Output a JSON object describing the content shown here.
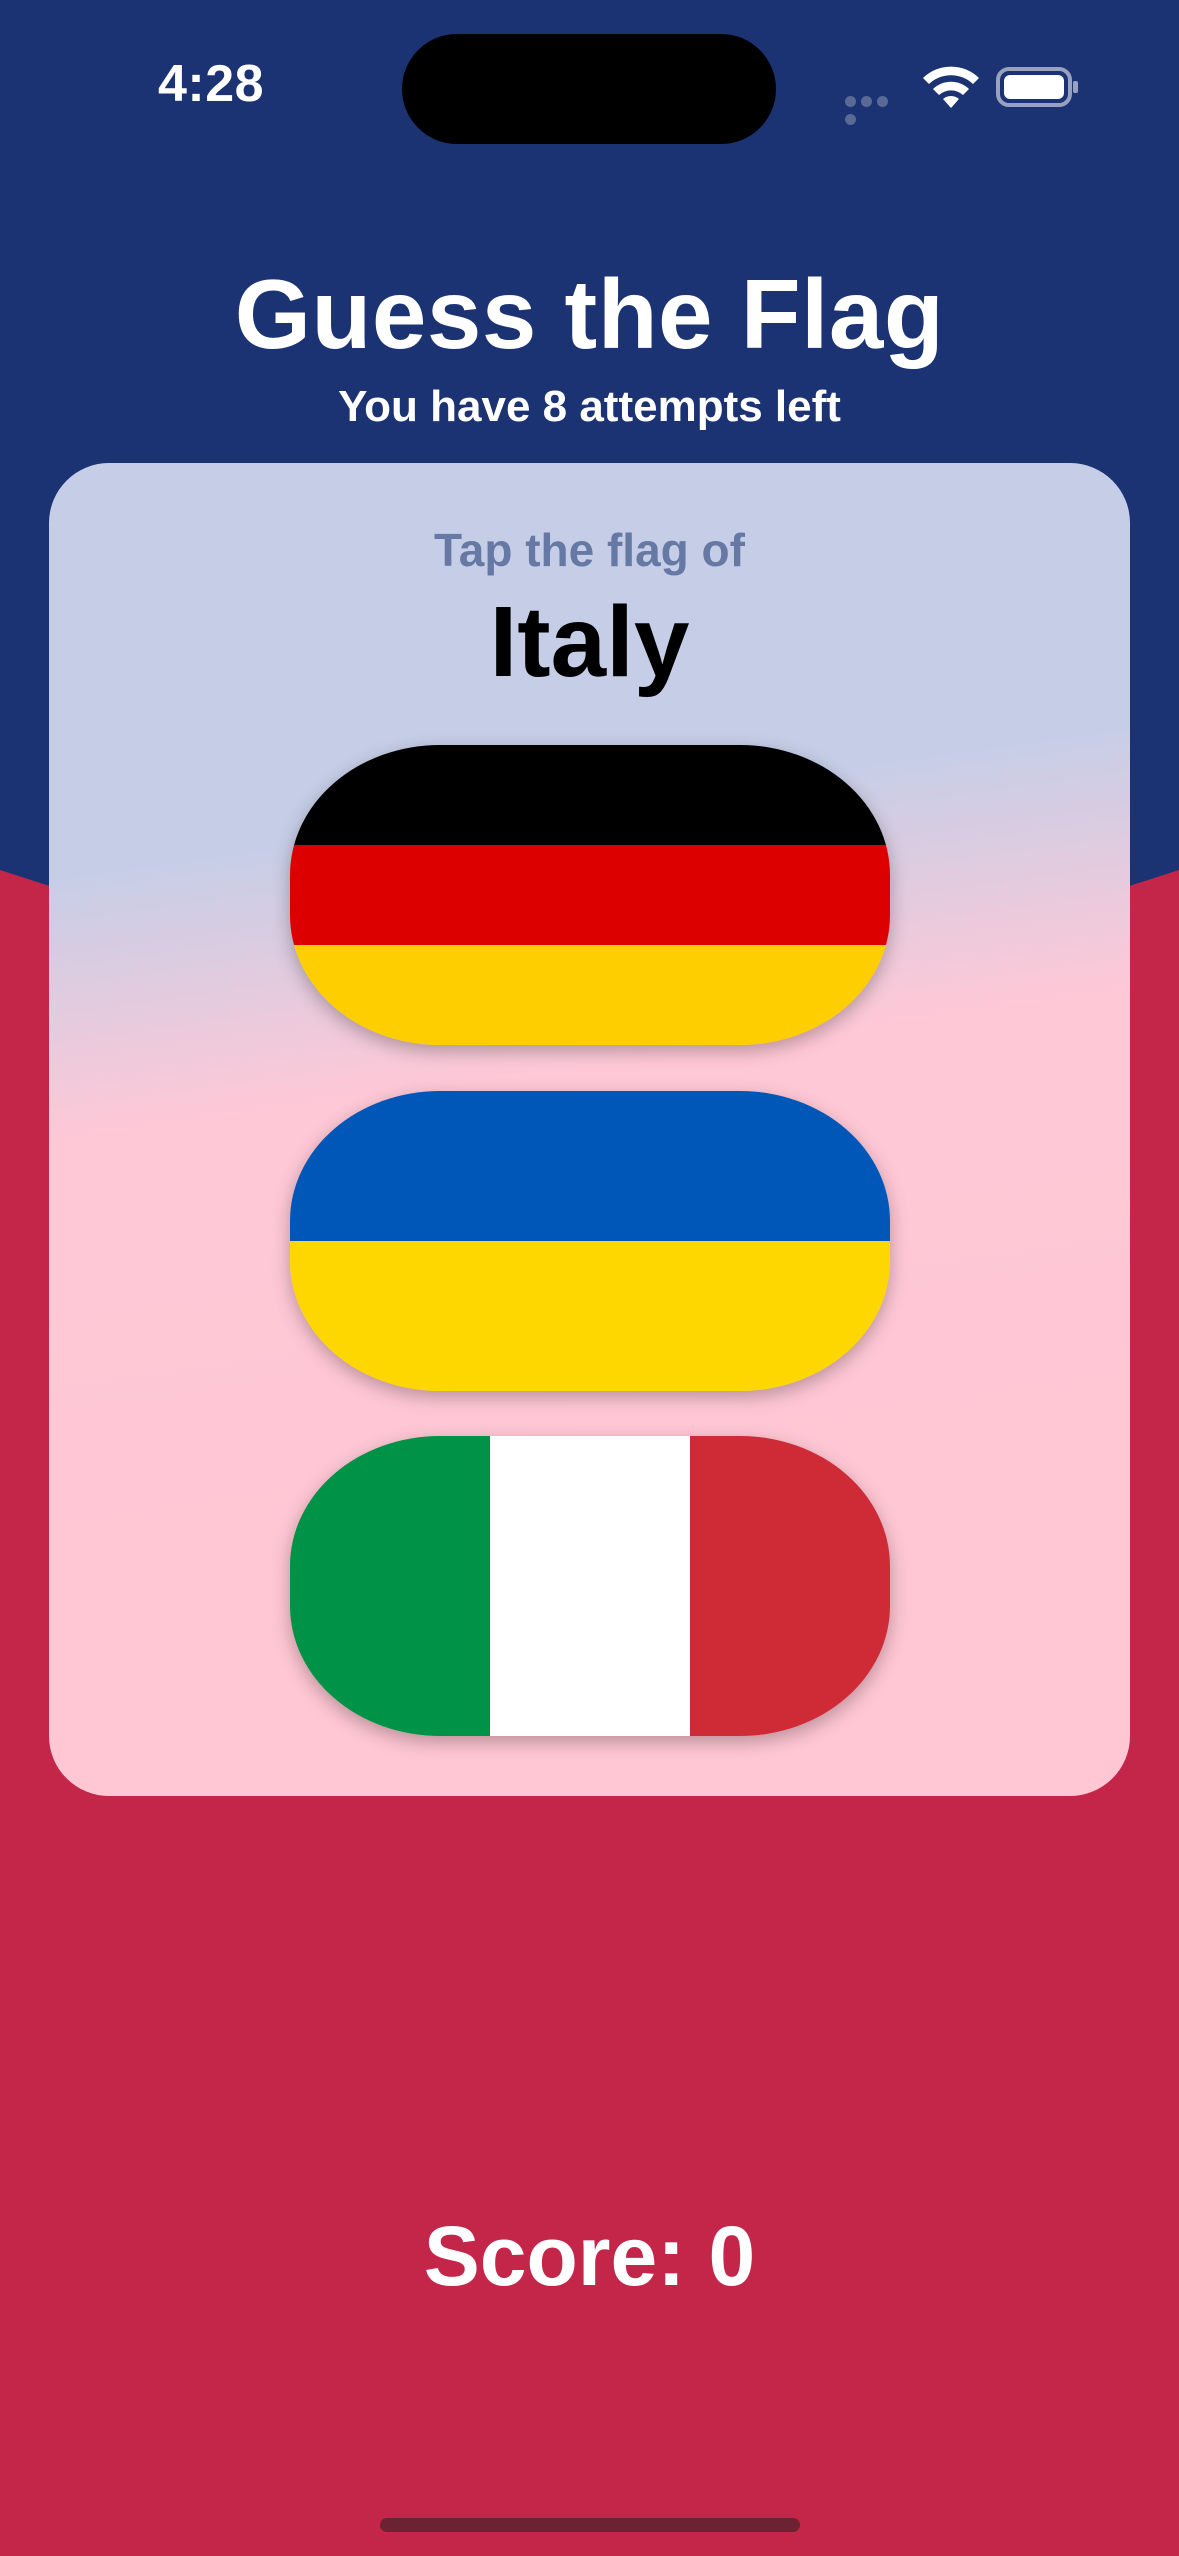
{
  "status_bar": {
    "time": "4:28",
    "wifi_icon": "wifi-icon",
    "battery_icon": "battery-icon"
  },
  "header": {
    "title": "Guess the Flag",
    "subtitle": "You have 8 attempts left"
  },
  "card": {
    "prompt": "Tap the flag of",
    "country": "Italy",
    "flags": [
      {
        "country": "Germany",
        "stripes": "horizontal",
        "colors": [
          "#000000",
          "#DD0000",
          "#FFCE00"
        ]
      },
      {
        "country": "Ukraine",
        "stripes": "horizontal",
        "colors": [
          "#0057B8",
          "#FFD700"
        ]
      },
      {
        "country": "Italy",
        "stripes": "vertical",
        "colors": [
          "#009246",
          "#FFFFFF",
          "#CE2B37"
        ]
      }
    ]
  },
  "footer": {
    "score": "Score: 0"
  },
  "colors": {
    "background_top": "#1B3273",
    "background_bottom": "#C4264A",
    "card_top": "#C6CEE7",
    "card_bottom": "#FFC6D3",
    "prompt_text": "#6678A4"
  }
}
